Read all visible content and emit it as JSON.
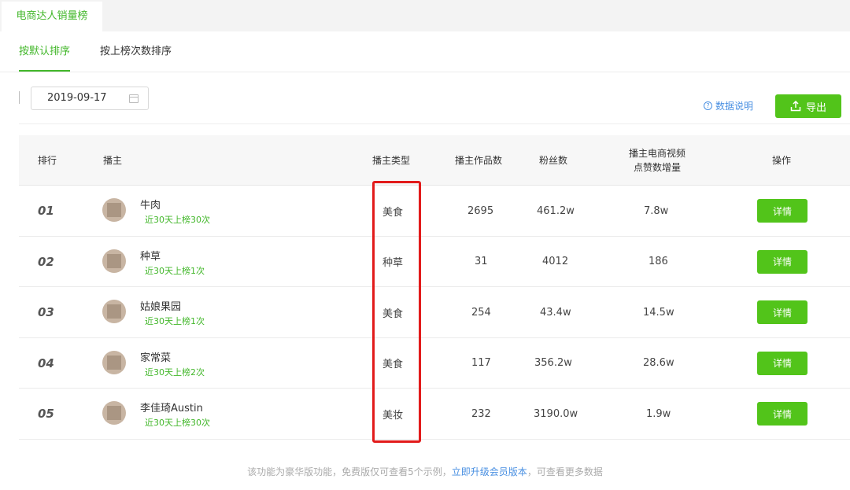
{
  "page_tab": "电商达人销量榜",
  "sort_tabs": [
    "按默认排序",
    "按上榜次数排序"
  ],
  "date_filter": "2019-09-17",
  "help_link": "数据说明",
  "export_label": "导出",
  "table": {
    "headers": {
      "rank": "排行",
      "anchor": "播主",
      "type": "播主类型",
      "works": "播主作品数",
      "fans": "粉丝数",
      "likes_line1": "播主电商视频",
      "likes_line2": "点赞数增量",
      "action": "操作"
    },
    "rows": [
      {
        "rank": "01",
        "name": "牛肉",
        "sub": "近30天上榜30次",
        "type": "美食",
        "works": "2695",
        "fans": "461.2w",
        "likes": "7.8w",
        "action": "详情"
      },
      {
        "rank": "02",
        "name": "种草",
        "sub": "近30天上榜1次",
        "type": "种草",
        "works": "31",
        "fans": "4012",
        "likes": "186",
        "action": "详情"
      },
      {
        "rank": "03",
        "name": "姑娘果园",
        "sub": "近30天上榜1次",
        "type": "美食",
        "works": "254",
        "fans": "43.4w",
        "likes": "14.5w",
        "action": "详情"
      },
      {
        "rank": "04",
        "name": "家常菜",
        "sub": "近30天上榜2次",
        "type": "美食",
        "works": "117",
        "fans": "356.2w",
        "likes": "28.6w",
        "action": "详情"
      },
      {
        "rank": "05",
        "name": "李佳琦Austin",
        "sub": "近30天上榜30次",
        "type": "美妆",
        "works": "232",
        "fans": "3190.0w",
        "likes": "1.9w",
        "action": "详情"
      }
    ]
  },
  "footer": {
    "before": "该功能为豪华版功能，免费版仅可查看5个示例，",
    "link": "立即升级会员版本",
    "after": "，可查看更多数据"
  }
}
